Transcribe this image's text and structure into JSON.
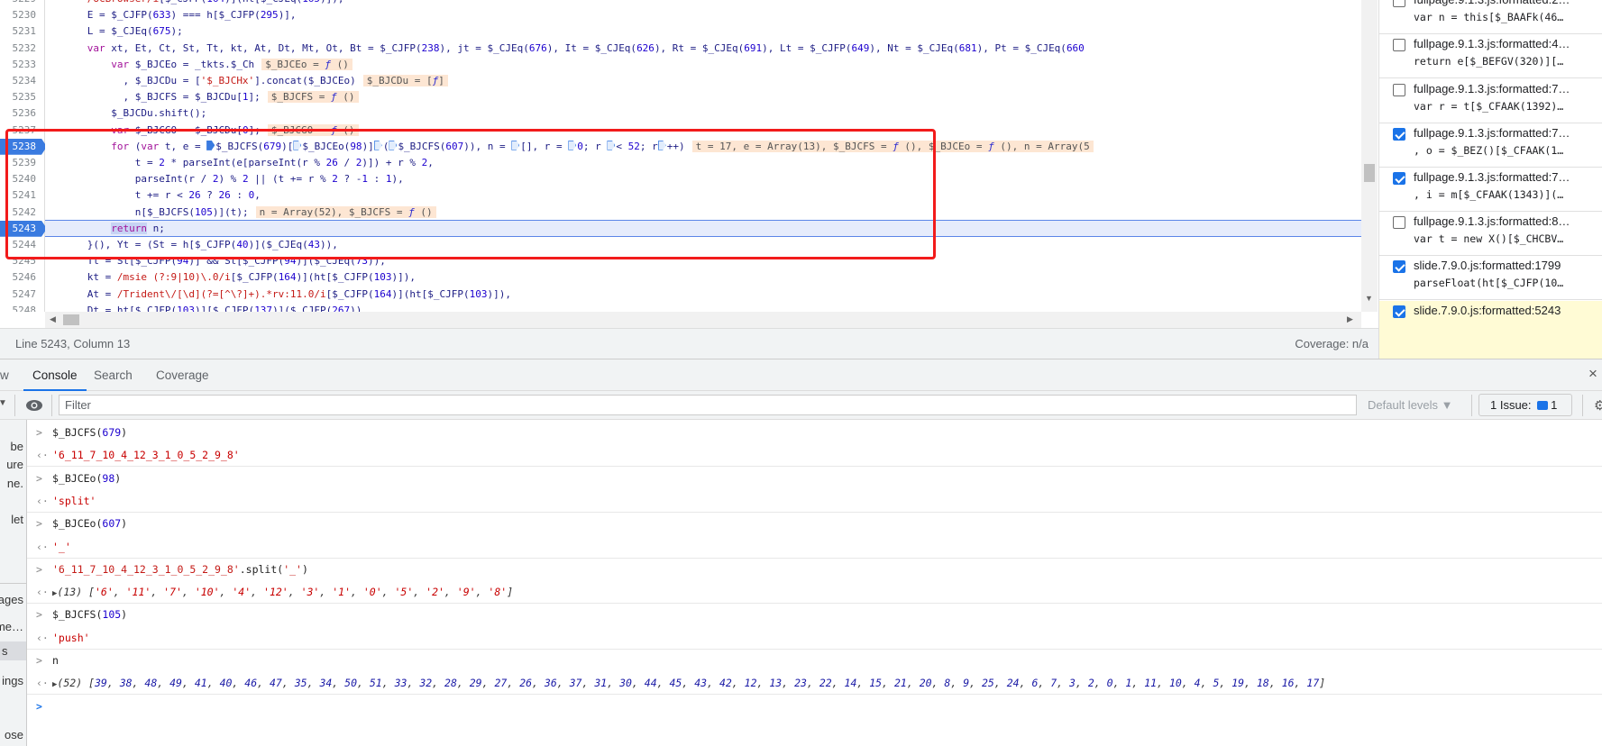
{
  "editor": {
    "first_line": 5229,
    "paused_line": 5243,
    "breakpoint_lines": [
      5238,
      5243
    ],
    "lines": [
      {
        "n": "5229",
        "code": "      /UCBrowser/i[$_CJFP(164)](ht[$_CJEq(165)]),"
      },
      {
        "n": "5230",
        "code": "      E = $_CJFP(633) === h[$_CJFP(295)],"
      },
      {
        "n": "5231",
        "code": "      L = $_CJEq(675);"
      },
      {
        "n": "5232",
        "code": "      var xt, Et, Ct, St, Tt, kt, At, Dt, Mt, Ot, Bt = $_CJFP(238), jt = $_CJEq(676), It = $_CJEq(626), Rt = $_CJEq(691), Lt = $_CJFP(649), Nt = $_CJEq(681), Pt = $_CJEq(660"
      },
      {
        "n": "5233",
        "code": "          var $_BJCEo = _tkts.$_Ch",
        "inline": "$_BJCEo = ƒ ()"
      },
      {
        "n": "5234",
        "code": "            , $_BJCDu = ['$_BJCHx'].concat($_BJCEo)",
        "inline": "$_BJCDu = [ƒ]"
      },
      {
        "n": "5235",
        "code": "            , $_BJCFS = $_BJCDu[1];",
        "inline": "$_BJCFS = ƒ ()"
      },
      {
        "n": "5236",
        "code": "          $_BJCDu.shift();"
      },
      {
        "n": "5237",
        "code": "          var $_BJCGO = $_BJCDu[0];",
        "inline": "$_BJCGO = ƒ ()"
      },
      {
        "n": "5238",
        "code": "          for (var t, e = ◆$_BJCFS(679)[◇$_BJCEo(98)]◇(◇$_BJCFS(607)), n = ◇[], r = ◇0; r ◇< 52; r◇++)",
        "inline": "t = 17, e = Array(13), $_BJCFS = ƒ (), $_BJCEo = ƒ (), n = Array(5"
      },
      {
        "n": "5239",
        "code": "              t = 2 * parseInt(e[parseInt(r % 26 / 2)]) + r % 2,"
      },
      {
        "n": "5240",
        "code": "              parseInt(r / 2) % 2 || (t += r % 2 ? -1 : 1),"
      },
      {
        "n": "5241",
        "code": "              t += r < 26 ? 26 : 0,"
      },
      {
        "n": "5242",
        "code": "              n[$_BJCFS(105)](t);",
        "inline": "n = Array(52), $_BJCFS = ƒ ()"
      },
      {
        "n": "5243",
        "code": "          return n;"
      },
      {
        "n": "5244",
        "code": "      }(), Yt = (St = h[$_CJFP(40)]($_CJEq(43)),"
      },
      {
        "n": "5245",
        "code": "      Tt = St[$_CJFP(94)] && St[$_CJFP(94)]($_CJEq(73)),"
      },
      {
        "n": "5246",
        "code": "      kt = /msie (?:9|10)\\.0/i[$_CJFP(164)](ht[$_CJFP(103)]),"
      },
      {
        "n": "5247",
        "code": "      At = /Trident\\/[\\d](?=[^\\?]+).*rv:11.0/i[$_CJFP(164)](ht[$_CJFP(103)]),"
      },
      {
        "n": "5248",
        "code": "      Dt = ht[$_CJFP(103)][$_CJFP(137)]($_CJFP(267)),"
      },
      {
        "n": "5249",
        "code": ""
      }
    ]
  },
  "status": {
    "position": "Line 5243, Column 13",
    "coverage": "Coverage: n/a"
  },
  "breakpoints": [
    {
      "file": "fullpage.9.1.3.js:formatted:2…",
      "code": "var n = this[$_BAAFk(46…",
      "checked": false
    },
    {
      "file": "fullpage.9.1.3.js:formatted:4…",
      "code": "return e[$_BEFGV(320)][…",
      "checked": false
    },
    {
      "file": "fullpage.9.1.3.js:formatted:7…",
      "code": "var r = t[$_CFAAK(1392)…",
      "checked": false
    },
    {
      "file": "fullpage.9.1.3.js:formatted:7…",
      "code": ", o = $_BEZ()[$_CFAAK(1…",
      "checked": true
    },
    {
      "file": "fullpage.9.1.3.js:formatted:7…",
      "code": ", i = m[$_CFAAK(1343)](…",
      "checked": true
    },
    {
      "file": "fullpage.9.1.3.js:formatted:8…",
      "code": "var t = new X()[$_CHCBV…",
      "checked": false
    },
    {
      "file": "slide.7.9.0.js:formatted:1799",
      "code": "parseFloat(ht[$_CJFP(10…",
      "checked": true
    },
    {
      "file": "slide.7.9.0.js:formatted:5238",
      "code": "for (var t, e = $_BJCFS…",
      "checked": true
    },
    {
      "file": "slide.7.9.0.js:formatted:5243",
      "code": "",
      "checked": true,
      "current": true
    }
  ],
  "drawer": {
    "tabs": [
      {
        "label": "w"
      },
      {
        "label": "Console",
        "active": true
      },
      {
        "label": "Search"
      },
      {
        "label": "Coverage"
      }
    ],
    "close": "×",
    "filter_placeholder": "Filter",
    "levels": "Default levels ▼",
    "issues_label": "1 Issue:",
    "issues_count": "1",
    "sidebar_fragments": [
      "be",
      "ure",
      "ne.",
      "let",
      "ages",
      "me…",
      "s",
      "ings",
      "ose"
    ]
  },
  "console": [
    {
      "input": "$_BJCFS(679)",
      "output": "'6_11_7_10_4_12_3_1_0_5_2_9_8'",
      "type": "string"
    },
    {
      "input": "$_BJCEo(98)",
      "output": "'split'",
      "type": "string"
    },
    {
      "input": "$_BJCEo(607)",
      "output": "'_'",
      "type": "string"
    },
    {
      "input": "'6_11_7_10_4_12_3_1_0_5_2_9_8'.split('_')",
      "type": "array",
      "count": "(13)",
      "items": [
        "'6'",
        "'11'",
        "'7'",
        "'10'",
        "'4'",
        "'12'",
        "'3'",
        "'1'",
        "'0'",
        "'5'",
        "'2'",
        "'9'",
        "'8'"
      ]
    },
    {
      "input": "$_BJCFS(105)",
      "output": "'push'",
      "type": "string"
    },
    {
      "input": "n",
      "type": "array",
      "count": "(52)",
      "items": [
        "39",
        "38",
        "48",
        "49",
        "41",
        "40",
        "46",
        "47",
        "35",
        "34",
        "50",
        "51",
        "33",
        "32",
        "28",
        "29",
        "27",
        "26",
        "36",
        "37",
        "31",
        "30",
        "44",
        "45",
        "43",
        "42",
        "12",
        "13",
        "23",
        "22",
        "14",
        "15",
        "21",
        "20",
        "8",
        "9",
        "25",
        "24",
        "6",
        "7",
        "3",
        "2",
        "0",
        "1",
        "11",
        "10",
        "4",
        "5",
        "19",
        "18",
        "16",
        "17"
      ]
    }
  ],
  "colors": {
    "accent": "#1a73e8",
    "breakpoint": "#3a7be0",
    "annotation_box": "#f21b1b",
    "paused_line": "#e6ecfc"
  }
}
